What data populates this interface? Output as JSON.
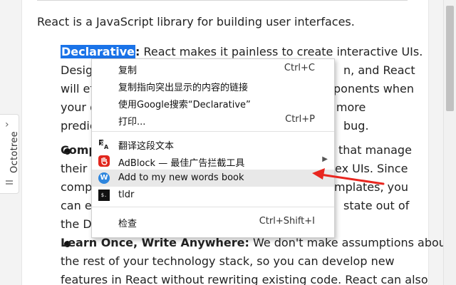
{
  "article": {
    "intro": "React is a JavaScript library for building user interfaces.",
    "declarative": {
      "title": "Declarative",
      "colon": ":",
      "lines": [
        " React makes it painless to create interactive UIs.",
        "Desig",
        "n, and React",
        "will ef",
        "ponents when",
        "your d",
        "e more",
        "predic",
        "bug."
      ]
    },
    "component": {
      "title_fragment": "Comp",
      "lines": [
        "that manage",
        "their c",
        "ex UIs. Since",
        "comp",
        "mplates, you",
        "can ea",
        "state out of",
        "the DO"
      ]
    },
    "learn_once": {
      "title": "Learn Once, Write Anywhere:",
      "lines": [
        " We don't make assumptions about",
        "the rest of your technology stack, so you can develop new",
        "features in React without rewriting existing code. React can also"
      ]
    }
  },
  "octotree": {
    "label": "Octotree",
    "chevron": "›"
  },
  "context_menu": {
    "items": [
      {
        "label": "复制",
        "shortcut": "Ctrl+C"
      },
      {
        "label": "复制指向突出显示的内容的链接",
        "shortcut": ""
      },
      {
        "label": "使用Google搜索“Declarative”",
        "shortcut": ""
      },
      {
        "label": "打印...",
        "shortcut": "Ctrl+P"
      },
      {
        "label": "翻译这段文本",
        "shortcut": "",
        "icon": "translate-icon"
      },
      {
        "label": "AdBlock — 最佳广告拦截工具",
        "shortcut": "",
        "icon": "adblock-icon",
        "submenu_arrow": "▶"
      },
      {
        "label": "Add to my new words book",
        "shortcut": "",
        "icon": "w-icon",
        "icon_text": "W"
      },
      {
        "label": "tldr",
        "shortcut": "",
        "icon": "tldr-icon",
        "icon_text": "$."
      },
      {
        "label": "检查",
        "shortcut": "Ctrl+Shift+I"
      }
    ]
  },
  "colors": {
    "selection": "#1a73e8",
    "hover": "#e8e8e8",
    "annotation_arrow": "#e8261f",
    "adblock": "#e1261c",
    "words_book": "#2e86de"
  }
}
